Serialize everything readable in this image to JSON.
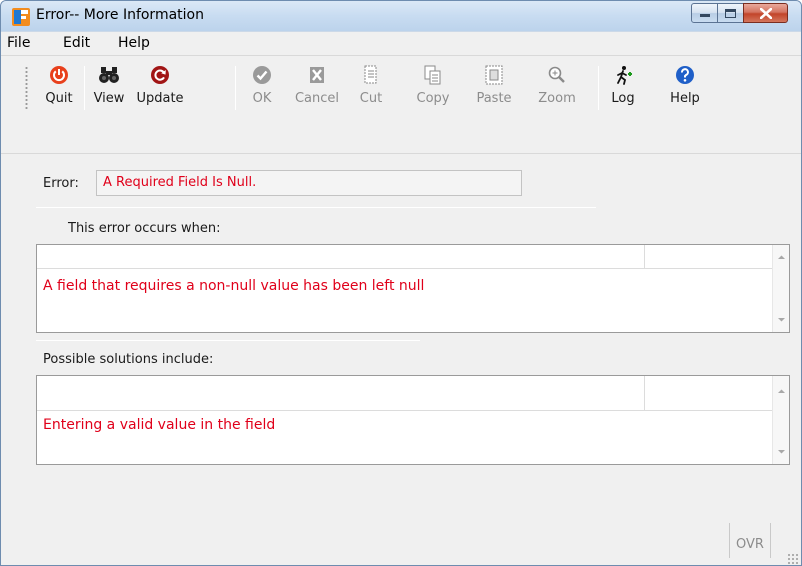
{
  "window": {
    "title": "Error-- More Information"
  },
  "menu": {
    "items": [
      "File",
      "Edit",
      "Help"
    ]
  },
  "toolbar": {
    "buttons": [
      {
        "label": "Quit",
        "icon": "power-icon",
        "enabled": true
      },
      {
        "label": "View",
        "icon": "binoculars-icon",
        "enabled": true
      },
      {
        "label": "Update",
        "icon": "refresh-icon",
        "enabled": true
      },
      {
        "label": "OK",
        "icon": "checkmark-icon",
        "enabled": false
      },
      {
        "label": "Cancel",
        "icon": "cancel-x-icon",
        "enabled": false
      },
      {
        "label": "Cut",
        "icon": "cut-icon",
        "enabled": false
      },
      {
        "label": "Copy",
        "icon": "copy-icon",
        "enabled": false
      },
      {
        "label": "Paste",
        "icon": "paste-icon",
        "enabled": false
      },
      {
        "label": "Zoom",
        "icon": "zoom-icon",
        "enabled": false
      },
      {
        "label": "Log",
        "icon": "log-runner-icon",
        "enabled": true
      },
      {
        "label": "Help",
        "icon": "help-icon",
        "enabled": true
      }
    ]
  },
  "error": {
    "label": "Error:",
    "value": "A Required Field Is Null."
  },
  "occurs": {
    "label": "This error occurs when:",
    "text": "A field that requires a non-null value has been left null"
  },
  "solutions": {
    "label": "Possible solutions include:",
    "text": "Entering a valid value in the field"
  },
  "status": {
    "ovr": "OVR"
  },
  "colors": {
    "error_text": "#e0001a",
    "disabled_text": "#8c8c8c"
  }
}
